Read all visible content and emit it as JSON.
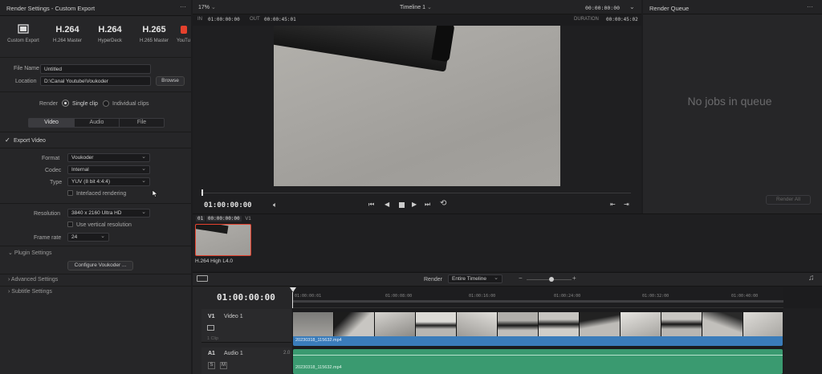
{
  "render_settings": {
    "title": "Render Settings - Custom Export",
    "presets": [
      {
        "big": "",
        "label": "Custom Export"
      },
      {
        "big": "H.264",
        "label": "H.264 Master"
      },
      {
        "big": "H.264",
        "label": "HyperDeck"
      },
      {
        "big": "H.265",
        "label": "H.265 Master"
      },
      {
        "big": "",
        "label": "YouTu"
      }
    ],
    "file_name_label": "File Name",
    "file_name_value": "Untitled",
    "location_label": "Location",
    "location_value": "D:\\Canal Youtube\\Voukoder",
    "browse_label": "Browse",
    "render_label": "Render",
    "single_clip": "Single clip",
    "individual_clips": "Individual clips",
    "tabs": [
      "Video",
      "Audio",
      "File"
    ],
    "export_video": "Export Video",
    "format_label": "Format",
    "format_value": "Voukoder",
    "codec_label": "Codec",
    "codec_value": "Internal",
    "type_label": "Type",
    "type_value": "YUV (8 bit 4:4:4)",
    "interlaced": "Interlaced rendering",
    "resolution_label": "Resolution",
    "resolution_value": "3840 x 2160 Ultra HD",
    "vertical_resolution": "Use vertical resolution",
    "frame_rate_label": "Frame rate",
    "frame_rate_value": "24",
    "plugin_settings": "Plugin Settings",
    "configure_button": "Configure Voukoder ...",
    "advanced_settings": "Advanced Settings",
    "subtitle_settings": "Subtitle Settings"
  },
  "viewer": {
    "zoom": "17%",
    "timeline_name": "Timeline 1",
    "top_timecode": "00:00:00:00",
    "in_label": "IN",
    "in_value": "01:00:00:00",
    "out_label": "OUT",
    "out_value": "00:00:45:01",
    "duration_label": "DURATION",
    "duration_value": "00:00:45:02",
    "current_tc": "01:00:00:00"
  },
  "render_queue": {
    "title": "Render Queue",
    "empty_text": "No jobs in queue",
    "render_all": "Render All"
  },
  "clips_strip": {
    "clip_header_index": "01",
    "clip_header_tc": "00:00:00:00",
    "clip_header_track": "V1",
    "clip_codec": "H.264 High L4.0"
  },
  "timeline": {
    "current_tc": "01:00:00:00",
    "render_label": "Render",
    "render_scope": "Entire Timeline",
    "ruler_ticks": [
      "01:00:00:01",
      "01:00:08:00",
      "01:00:16:00",
      "01:00:24:00",
      "01:00:32:00",
      "01:00:40:00"
    ],
    "video_track_id": "V1",
    "video_track_name": "Video 1",
    "video_track_clips": "1 Clip",
    "audio_track_id": "A1",
    "audio_track_name": "Audio 1",
    "audio_track_channels": "2.0",
    "video_clip_name": "20230318_115632.mp4",
    "audio_clip_name": "20230318_115632.mp4",
    "solo": "S",
    "mute": "M"
  },
  "colors": {
    "accent_red": "#e5412d",
    "video_clip": "#3a7cba",
    "audio_clip": "#3a9a70",
    "panel": "#262628"
  }
}
